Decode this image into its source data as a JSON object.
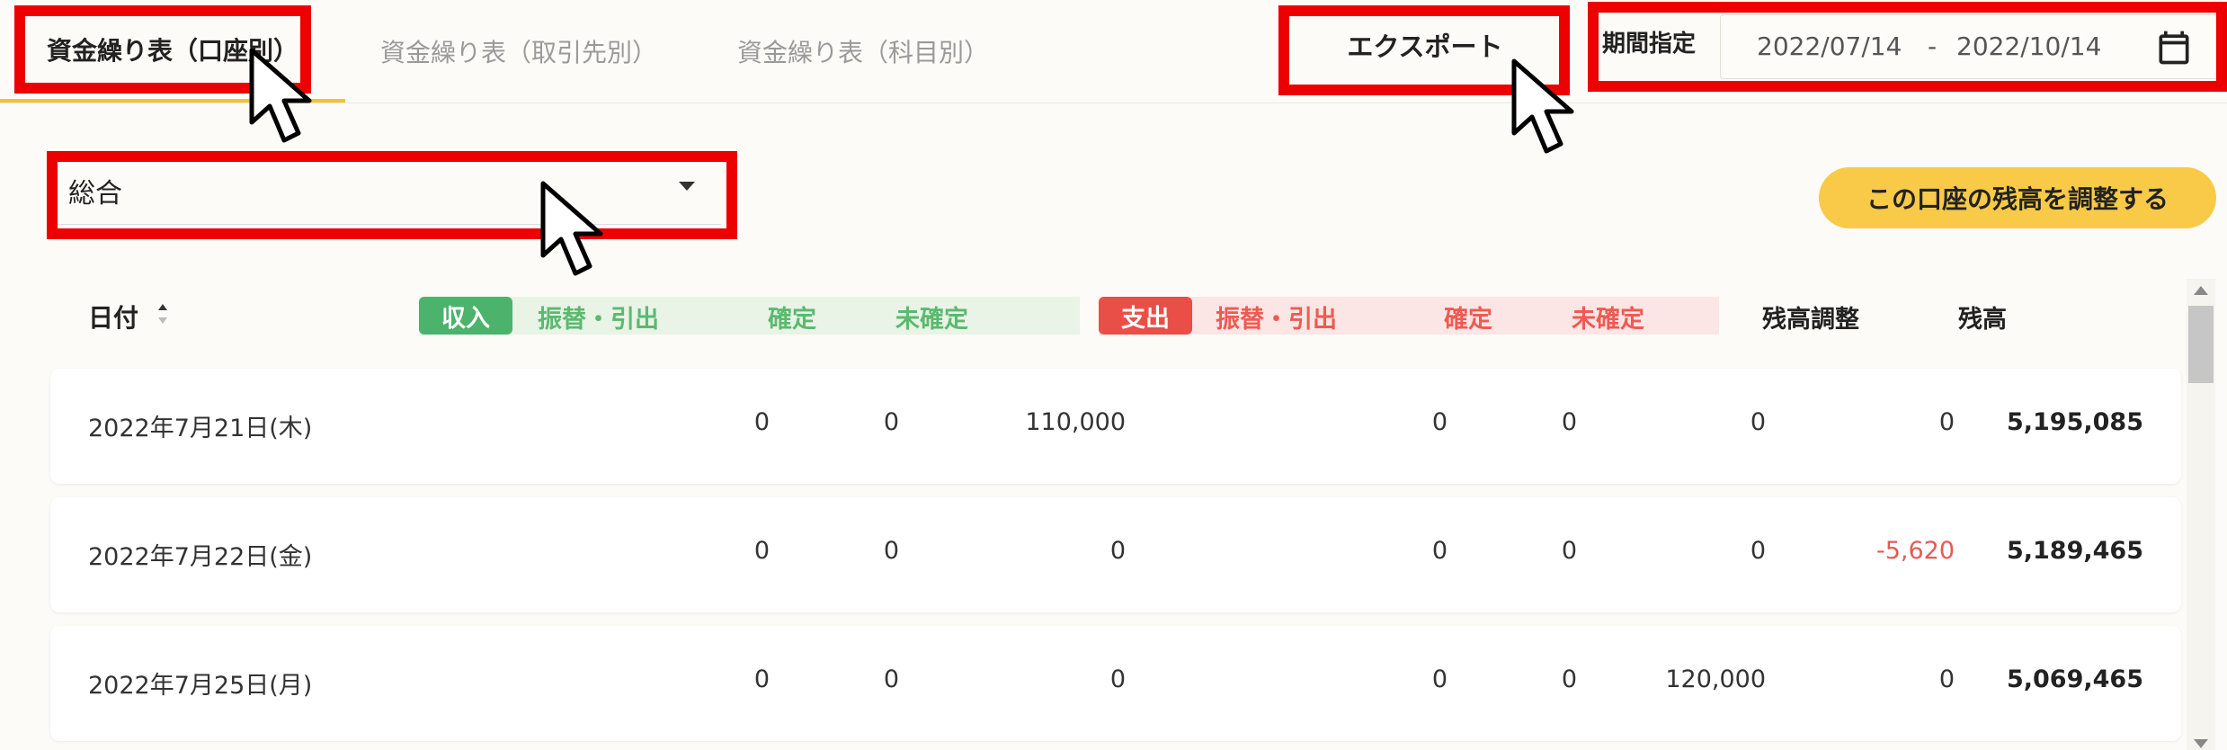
{
  "tabs": [
    {
      "label": "資金繰り表（口座別）",
      "active": true
    },
    {
      "label": "資金繰り表（取引先別）",
      "active": false
    },
    {
      "label": "資金繰り表（科目別）",
      "active": false
    }
  ],
  "toolbar": {
    "export_label": "エクスポート",
    "period_label": "期間指定",
    "date_start": "2022/07/14",
    "date_sep": "-",
    "date_end": "2022/10/14"
  },
  "account_select": {
    "value": "総合"
  },
  "adjust_button": "この口座の残高を調整する",
  "table": {
    "headers": {
      "date": "日付",
      "income_badge": "収入",
      "income_transfer": "振替・引出",
      "income_confirmed": "確定",
      "income_unconfirmed": "未確定",
      "expense_badge": "支出",
      "expense_transfer": "振替・引出",
      "expense_confirmed": "確定",
      "expense_unconfirmed": "未確定",
      "adjustment": "残高調整",
      "balance": "残高"
    },
    "rows": [
      {
        "date": "2022年7月21日(木)",
        "in_transfer": "0",
        "in_confirmed": "0",
        "in_unconfirmed": "110,000",
        "out_transfer": "0",
        "out_confirmed": "0",
        "out_unconfirmed": "0",
        "adjustment": "0",
        "balance": "5,195,085"
      },
      {
        "date": "2022年7月22日(金)",
        "in_transfer": "0",
        "in_confirmed": "0",
        "in_unconfirmed": "0",
        "out_transfer": "0",
        "out_confirmed": "0",
        "out_unconfirmed": "0",
        "adjustment": "-5,620",
        "balance": "5,189,465"
      },
      {
        "date": "2022年7月25日(月)",
        "in_transfer": "0",
        "in_confirmed": "0",
        "in_unconfirmed": "0",
        "out_transfer": "0",
        "out_confirmed": "0",
        "out_unconfirmed": "120,000",
        "adjustment": "0",
        "balance": "5,069,465"
      }
    ]
  },
  "colors": {
    "accent_yellow": "#f8ca47",
    "income_green": "#4bb36b",
    "expense_red": "#ea4f47",
    "annotation_red": "#ec0000"
  },
  "icons": [
    "calendar-icon",
    "sort-icon",
    "chevron-down-icon",
    "cursor-arrow-icon"
  ]
}
